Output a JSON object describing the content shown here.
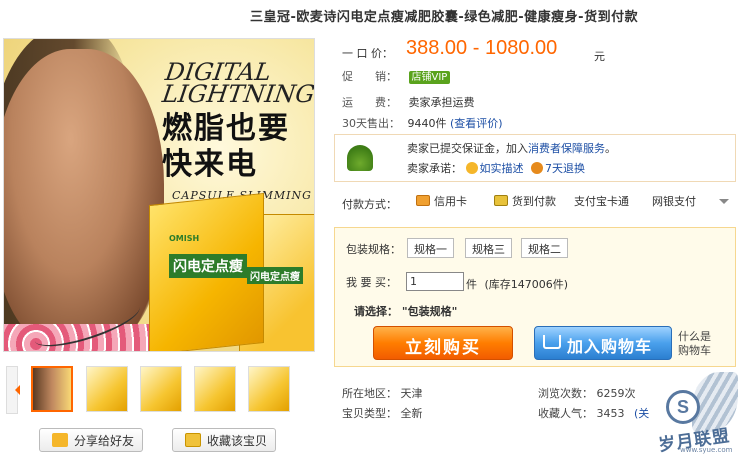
{
  "title": "三皇冠-欧麦诗闪电定点瘦减肥胶囊-绿色减肥-健康瘦身-货到付款",
  "image": {
    "brand_en": "DIGITAL LIGHTNING",
    "slogan_line1": "燃脂也要",
    "slogan_line2": "快来电",
    "capsule_text": "CAPSULE SLIMMING",
    "box_label": "闪电定点瘦",
    "box_label_small": "闪电定点瘦",
    "box_brand": "OMISH"
  },
  "price": {
    "label": "一 口 价：",
    "value": "388.00 - 1080.00",
    "unit": "元"
  },
  "promo": {
    "label": "促　　销：",
    "badge": "店铺VIP"
  },
  "shipping": {
    "label": "运　　费：",
    "value": "卖家承担运费"
  },
  "sales": {
    "label": "30天售出：",
    "count": "9440件",
    "link": "(查看评价)"
  },
  "promise": {
    "line1_prefix": "卖家已提交保证金，加入",
    "line1_link": "消费者保障服务",
    "line1_suffix": "。",
    "line2_label": "卖家承诺：",
    "item1": "如实描述",
    "item2": "7天退换"
  },
  "payment": {
    "label": "付款方式：",
    "methods": [
      "信用卡",
      "货到付款",
      "支付宝卡通",
      "网银支付"
    ]
  },
  "buy": {
    "spec_label": "包装规格：",
    "specs": [
      "规格一",
      "规格三",
      "规格二"
    ],
    "qty_label": "我 要 买：",
    "qty_value": "1",
    "qty_unit": "件",
    "stock": "(库存147006件)",
    "select_prompt_label": "请选择：",
    "select_prompt_value": "\"包装规格\"",
    "buy_now": "立刻购买",
    "add_cart": "加入购物车",
    "what_is": "什么是",
    "cart_word": "购物车"
  },
  "info": {
    "location_label": "所在地区：",
    "location": "天津",
    "views_label": "浏览次数：",
    "views": "6259次",
    "type_label": "宝贝类型：",
    "type": "全新",
    "fav_label": "收藏人气：",
    "fav": "3453",
    "fav_link": "(关"
  },
  "actions": {
    "share": "分享给好友",
    "collect": "收藏该宝贝"
  },
  "watermark": {
    "text": "岁月联盟",
    "url": "www.syue.com",
    "letter": "S"
  },
  "colors": {
    "price": "#ff6600",
    "buy": "#ff7d00",
    "cart": "#4aa0ec",
    "link": "#1d4fa5",
    "vip": "#5aa31d"
  }
}
